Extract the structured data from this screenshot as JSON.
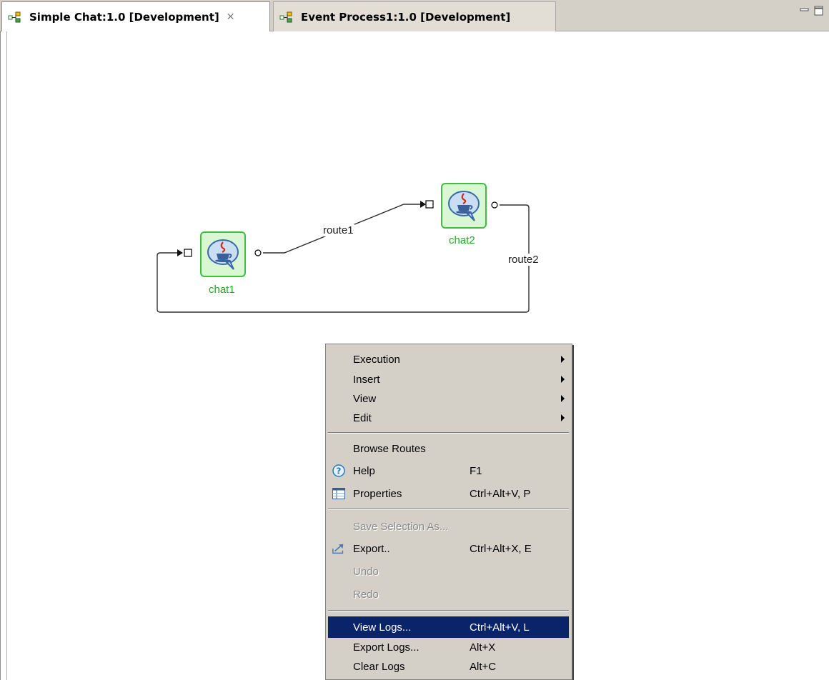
{
  "tabs": [
    {
      "label": "Simple Chat:1.0 [Development]",
      "active": true,
      "close": "✕"
    },
    {
      "label": "Event Process1:1.0 [Development]",
      "active": false
    }
  ],
  "diagram": {
    "nodes": [
      {
        "label": "chat1"
      },
      {
        "label": "chat2"
      }
    ],
    "routes": [
      {
        "label": "route1"
      },
      {
        "label": "route2"
      }
    ]
  },
  "context_menu": {
    "items": [
      {
        "label": "Execution",
        "submenu": true
      },
      {
        "label": "Insert",
        "submenu": true
      },
      {
        "label": "View",
        "submenu": true
      },
      {
        "label": "Edit",
        "submenu": true
      },
      {
        "label": "Browse Routes"
      },
      {
        "label": "Help",
        "shortcut": "F1",
        "icon": "help-icon"
      },
      {
        "label": "Properties",
        "shortcut": "Ctrl+Alt+V, P",
        "icon": "properties-table-icon"
      },
      {
        "label": "Save Selection As...",
        "disabled": true
      },
      {
        "label": "Export..",
        "shortcut": "Ctrl+Alt+X, E",
        "icon": "export-icon"
      },
      {
        "label": "Undo",
        "disabled": true
      },
      {
        "label": "Redo",
        "disabled": true
      },
      {
        "label": "View Logs...",
        "shortcut": "Ctrl+Alt+V, L",
        "selected": true
      },
      {
        "label": "Export Logs...",
        "shortcut": "Alt+X"
      },
      {
        "label": "Clear Logs",
        "shortcut": "Alt+C"
      }
    ],
    "selected_color": "#0a246a"
  }
}
